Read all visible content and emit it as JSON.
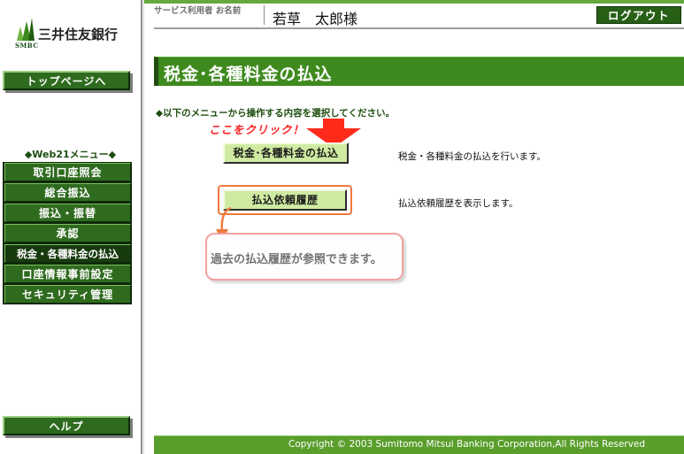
{
  "brand": {
    "logo_text": "三井住友銀行",
    "logo_sub": "SMBC",
    "colors": {
      "primary_green": "#2e6b1e",
      "title_green": "#3f8a1f",
      "button_light_green": "#cfeba2",
      "hint_red": "#ff2020",
      "highlight_orange": "#f07a3e"
    }
  },
  "sidebar": {
    "top_button": "トップページへ",
    "menu_heading": "◆Web21メニュー◆",
    "items": [
      {
        "label": "取引口座照会",
        "active": false
      },
      {
        "label": "総合振込",
        "active": false
      },
      {
        "label": "振込・振替",
        "active": false
      },
      {
        "label": "承認",
        "active": false
      },
      {
        "label": "税金・各種料金の払込",
        "active": true
      },
      {
        "label": "口座情報事前設定",
        "active": false
      },
      {
        "label": "セキュリティ管理",
        "active": false
      }
    ],
    "help_button": "ヘルプ"
  },
  "header": {
    "user_caption": "サービス利用者 お名前",
    "user_name": "若草　太郎様",
    "logout_button": "ログアウト"
  },
  "main": {
    "title": "税金･各種料金の払込",
    "instruction": "◆以下のメニューから操作する内容を選択してください。",
    "click_hint": "ここをクリック！",
    "actions": [
      {
        "label": "税金･各種料金の払込",
        "description": "税金・各種料金の払込を行います。"
      },
      {
        "label": "払込依頼履歴",
        "description": "払込依頼履歴を表示します。"
      }
    ],
    "callout_text": "過去の払込履歴が参照できます。"
  },
  "footer": {
    "copyright": "Copyright © 2003 Sumitomo Mitsui Banking Corporation,All Rights Reserved"
  }
}
